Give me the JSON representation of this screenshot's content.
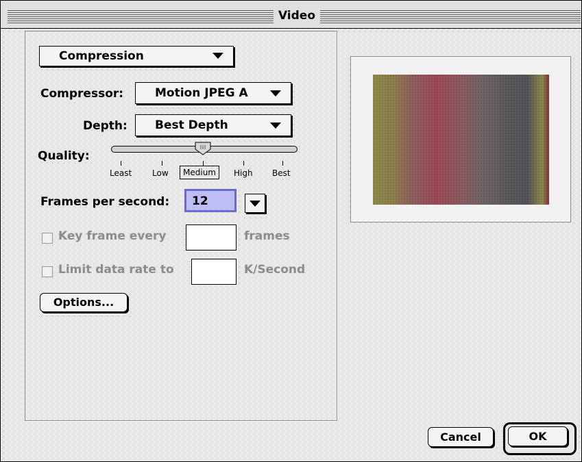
{
  "window": {
    "title": "Video"
  },
  "section_popup": {
    "label": "Compression"
  },
  "compressor": {
    "label": "Compressor:",
    "value": "Motion JPEG A"
  },
  "depth": {
    "label": "Depth:",
    "value": "Best Depth"
  },
  "quality": {
    "label": "Quality:",
    "ticks": [
      "Least",
      "Low",
      "Medium",
      "High",
      "Best"
    ],
    "selected": "Medium",
    "level_fraction": 0.5
  },
  "fps": {
    "label": "Frames per second:",
    "value": "12"
  },
  "keyframe": {
    "label": "Key frame every",
    "value": "",
    "unit": "frames",
    "checked": false
  },
  "datarate": {
    "label": "Limit data rate to",
    "value": "",
    "unit": "K/Second",
    "checked": false
  },
  "buttons": {
    "options": "Options...",
    "cancel": "Cancel",
    "ok": "OK"
  },
  "colors": {
    "fps_field_bg": "#bdbdf4",
    "fps_field_border": "#6c6cc8",
    "disabled_text": "#8c8c8c"
  }
}
